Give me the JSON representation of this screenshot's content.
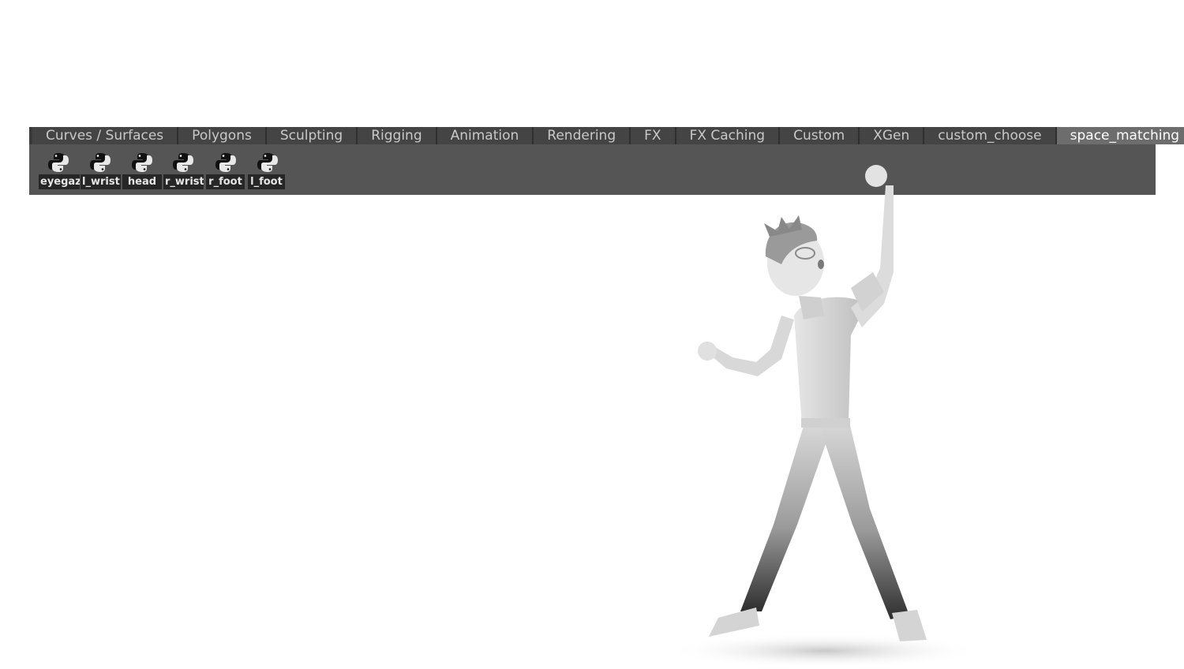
{
  "tabs": [
    {
      "label": "Curves / Surfaces",
      "active": false
    },
    {
      "label": "Polygons",
      "active": false
    },
    {
      "label": "Sculpting",
      "active": false
    },
    {
      "label": "Rigging",
      "active": false
    },
    {
      "label": "Animation",
      "active": false
    },
    {
      "label": "Rendering",
      "active": false
    },
    {
      "label": "FX",
      "active": false
    },
    {
      "label": "FX Caching",
      "active": false
    },
    {
      "label": "Custom",
      "active": false
    },
    {
      "label": "XGen",
      "active": false
    },
    {
      "label": "custom_choose",
      "active": false
    },
    {
      "label": "space_matching",
      "active": true
    }
  ],
  "shelf_buttons": [
    {
      "label": "eyegaz",
      "icon": "python-icon"
    },
    {
      "label": "l_wrist",
      "icon": "python-icon"
    },
    {
      "label": "head",
      "icon": "python-icon"
    },
    {
      "label": "r_wrist",
      "icon": "python-icon"
    },
    {
      "label": "r_foot",
      "icon": "python-icon"
    },
    {
      "label": "l_foot",
      "icon": "python-icon"
    }
  ],
  "colors": {
    "shelf_bg": "#555555",
    "tab_bar_bg": "#444444",
    "active_tab_bg": "#6d6d6d"
  }
}
